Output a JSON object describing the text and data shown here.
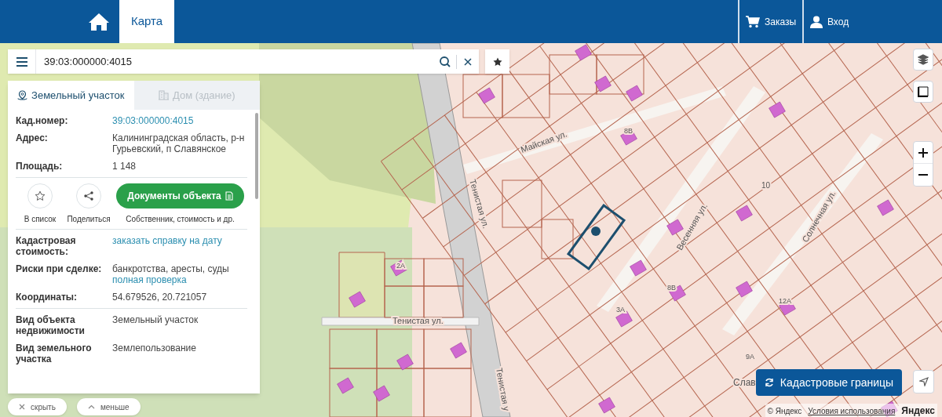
{
  "header": {
    "tabs": [
      {
        "label": "Карта",
        "selected": true
      }
    ],
    "links": [
      {
        "kind": "cart",
        "label": "Заказы"
      },
      {
        "kind": "user",
        "label": "Вход"
      }
    ]
  },
  "search": {
    "value": "39:03:000000:4015"
  },
  "panel": {
    "tabs": [
      {
        "kind": "land",
        "label": "Земельный участок",
        "selected": true
      },
      {
        "kind": "building",
        "label": "Дом (здание)",
        "selected": false
      }
    ],
    "sections": [
      {
        "kind": "fields",
        "rows": [
          {
            "label": "Кад.номер:",
            "lines": [
              {
                "kind": "link",
                "text": "39:03:000000:4015"
              }
            ]
          },
          {
            "label": "Адрес:",
            "lines": [
              {
                "kind": "text",
                "text": "Калининградская область, р-н Гурьевский, п Славянское"
              }
            ]
          },
          {
            "label": "Площадь:",
            "lines": [
              {
                "kind": "text",
                "text": "1 148"
              }
            ]
          }
        ]
      },
      {
        "kind": "actions",
        "buttons": [
          {
            "kind": "star",
            "label": "В список"
          },
          {
            "kind": "share",
            "label": "Поделиться"
          }
        ],
        "primary": {
          "label": "Документы объекта",
          "caption": "Собственник, стоимость и др."
        }
      },
      {
        "kind": "fields",
        "rows": [
          {
            "label": "Кадастровая стоимость:",
            "lines": [
              {
                "kind": "link",
                "text": "заказать справку на дату"
              }
            ]
          },
          {
            "label": "Риски при сделке:",
            "lines": [
              {
                "kind": "text",
                "text": "банкротства, аресты, суды"
              },
              {
                "kind": "link",
                "text": "полная проверка"
              }
            ]
          },
          {
            "label": "Координаты:",
            "lines": [
              {
                "kind": "text",
                "text": "54.679526, 20.721057"
              }
            ]
          }
        ]
      },
      {
        "kind": "fields",
        "rows": [
          {
            "label": "Вид объекта недвижимости",
            "lines": [
              {
                "kind": "text",
                "text": "Земельный участок"
              }
            ]
          },
          {
            "label": "Вид земельного участка",
            "lines": [
              {
                "kind": "text",
                "text": "Землепользование"
              }
            ]
          }
        ]
      }
    ]
  },
  "bottom_buttons": [
    {
      "kind": "close",
      "label": "скрыть"
    },
    {
      "kind": "caret",
      "label": "меньше"
    }
  ],
  "map": {
    "labels": [
      {
        "text": "Майская ул."
      },
      {
        "text": "Тенистая ул."
      },
      {
        "text": "Весенняя ул."
      },
      {
        "text": "Солнечная ул."
      },
      {
        "text": "Тенистая ул."
      },
      {
        "text": "Тенистая у"
      },
      {
        "text": "Слав"
      },
      {
        "text": "10"
      },
      {
        "text": "3А"
      },
      {
        "text": "2А"
      },
      {
        "text": "8В"
      },
      {
        "text": "12А"
      },
      {
        "text": "9А"
      },
      {
        "text": "8В"
      }
    ]
  },
  "cadastral_button": {
    "label": "Кадастровые границы"
  },
  "attribution": {
    "copyright": "© Яндекс",
    "terms": "Условия использования",
    "logo": "Яндекс"
  }
}
